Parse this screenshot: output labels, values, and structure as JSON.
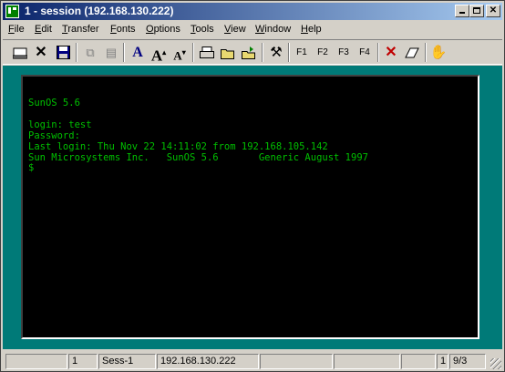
{
  "window": {
    "title": "1 - session (192.168.130.222)"
  },
  "menus": [
    {
      "label": "File"
    },
    {
      "label": "Edit"
    },
    {
      "label": "Transfer"
    },
    {
      "label": "Fonts"
    },
    {
      "label": "Options"
    },
    {
      "label": "Tools"
    },
    {
      "label": "View"
    },
    {
      "label": "Window"
    },
    {
      "label": "Help"
    }
  ],
  "toolbar": {
    "f1": "F1",
    "f2": "F2",
    "f3": "F3",
    "f4": "F4",
    "icons": [
      "connect-icon",
      "disconnect-icon",
      "save-icon",
      "copy-icon",
      "paste-icon",
      "font-icon",
      "font-larger-icon",
      "font-smaller-icon",
      "print-icon",
      "open-folder-icon",
      "send-file-icon",
      "tools-icon",
      "f1-key",
      "f2-key",
      "f3-key",
      "f4-key",
      "stop-icon",
      "eraser-icon",
      "hand-icon"
    ]
  },
  "terminal": {
    "lines": "SunOS 5.6\n\nlogin: test\nPassword:\nLast login: Thu Nov 22 14:11:02 from 192.168.105.142\nSun Microsystems Inc.   SunOS 5.6       Generic August 1997\n$",
    "fg_color": "#00c000",
    "bg_color": "#000000",
    "frame_color": "#007a78"
  },
  "status": {
    "cell1": "",
    "cell2": "1",
    "cell3": "Sess-1",
    "cell4": "192.168.130.222",
    "cell5": "",
    "cell6": "",
    "cell7": "",
    "cell8": "1",
    "cell9": "9/3"
  }
}
